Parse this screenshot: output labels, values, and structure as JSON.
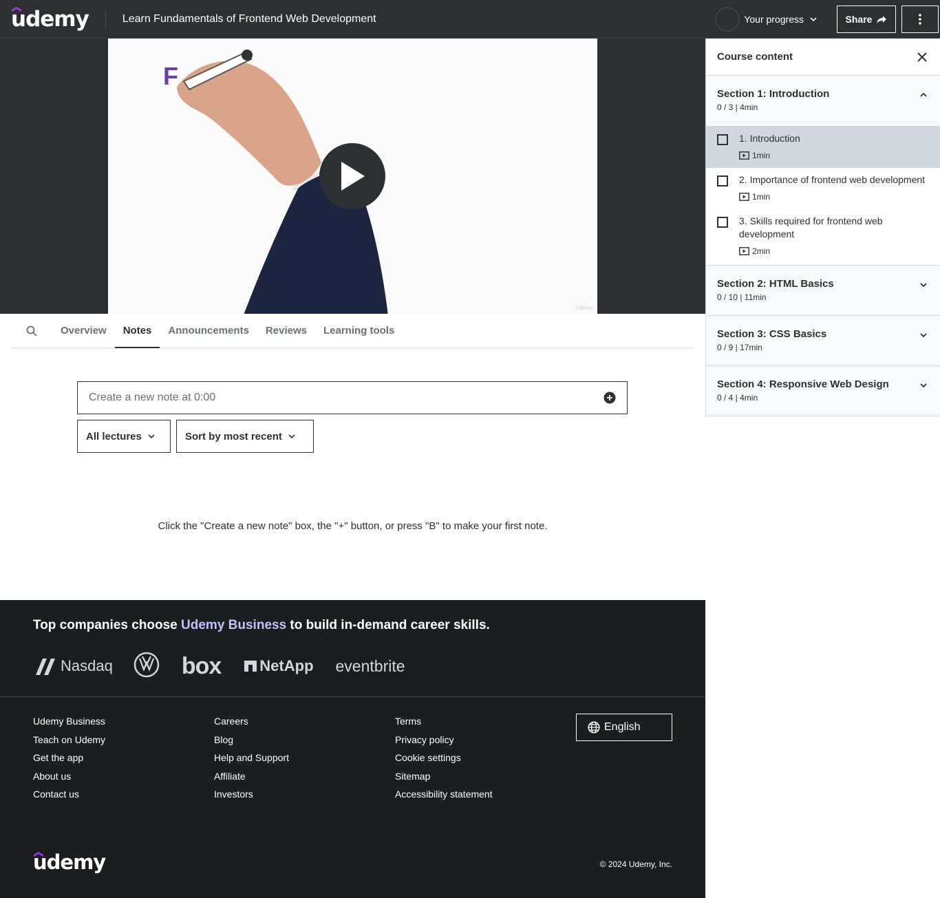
{
  "header": {
    "logo": "udemy",
    "course_title": "Learn Fundamentals of Frontend Web Development",
    "progress_label": "Your progress",
    "share_label": "Share",
    "progress_fraction": 0
  },
  "video": {
    "watermark": "Udemy",
    "board_letter": "F"
  },
  "tabs": [
    {
      "label": "Overview"
    },
    {
      "label": "Notes"
    },
    {
      "label": "Announcements"
    },
    {
      "label": "Reviews"
    },
    {
      "label": "Learning tools"
    }
  ],
  "active_tab": "Notes",
  "notes": {
    "input_placeholder": "Create a new note at 0:00",
    "filter_label": "All lectures",
    "sort_label": "Sort by most recent",
    "empty_message": "Click the \"Create a new note\" box, the \"+\" button, or press \"B\" to make your first note."
  },
  "sidebar": {
    "title": "Course content",
    "sections": [
      {
        "title": "Section 1: Introduction",
        "meta": "0 / 3 | 4min",
        "expanded": true,
        "lectures": [
          {
            "title": "1. Introduction",
            "duration": "1min",
            "current": true
          },
          {
            "title": "2. Importance of frontend web development",
            "duration": "1min",
            "current": false
          },
          {
            "title": "3. Skills required for frontend web development",
            "duration": "2min",
            "current": false
          }
        ]
      },
      {
        "title": "Section 2: HTML Basics",
        "meta": "0 / 10 | 11min",
        "expanded": false
      },
      {
        "title": "Section 3: CSS Basics",
        "meta": "0 / 9 | 17min",
        "expanded": false
      },
      {
        "title": "Section 4: Responsive Web Design",
        "meta": "0 / 4 | 4min",
        "expanded": false
      }
    ]
  },
  "footer": {
    "biz_prefix": "Top companies choose ",
    "biz_link": "Udemy Business",
    "biz_suffix": " to build in-demand career skills.",
    "brands": [
      "Nasdaq",
      "box",
      "NetApp",
      "eventbrite"
    ],
    "col1": [
      "Udemy Business",
      "Teach on Udemy",
      "Get the app",
      "About us",
      "Contact us"
    ],
    "col2": [
      "Careers",
      "Blog",
      "Help and Support",
      "Affiliate",
      "Investors"
    ],
    "col3": [
      "Terms",
      "Privacy policy",
      "Cookie settings",
      "Sitemap",
      "Accessibility statement"
    ],
    "language": "English",
    "logo": "udemy",
    "copyright": "© 2024 Udemy, Inc."
  },
  "colors": {
    "header_bg": "#2d2f31",
    "footer_bg": "#1c1d1f",
    "brand_purple": "#a435f0",
    "biz_link": "#c0c4fc"
  }
}
